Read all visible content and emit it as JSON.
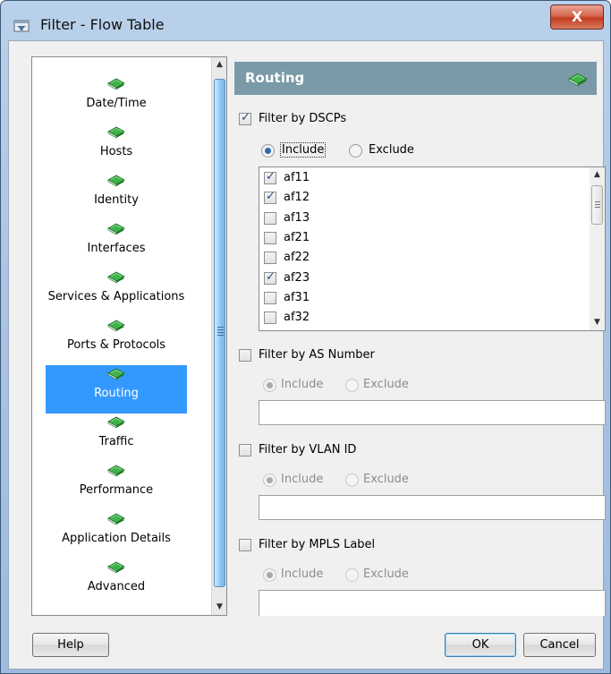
{
  "window": {
    "title": "Filter - Flow Table",
    "close_label": "X"
  },
  "nav": {
    "items": [
      {
        "label": "Date/Time"
      },
      {
        "label": "Hosts"
      },
      {
        "label": "Identity"
      },
      {
        "label": "Interfaces"
      },
      {
        "label": "Services & Applications"
      },
      {
        "label": "Ports & Protocols"
      },
      {
        "label": "Routing",
        "active": true
      },
      {
        "label": "Traffic"
      },
      {
        "label": "Performance"
      },
      {
        "label": "Application Details"
      },
      {
        "label": "Advanced"
      }
    ]
  },
  "panel": {
    "title": "Routing",
    "dscp": {
      "label": "Filter by DSCPs",
      "checked": true,
      "include_label": "Include",
      "exclude_label": "Exclude",
      "selected": "Include",
      "items": [
        {
          "label": "af11",
          "checked": true
        },
        {
          "label": "af12",
          "checked": true
        },
        {
          "label": "af13",
          "checked": false
        },
        {
          "label": "af21",
          "checked": false
        },
        {
          "label": "af22",
          "checked": false
        },
        {
          "label": "af23",
          "checked": true
        },
        {
          "label": "af31",
          "checked": false
        },
        {
          "label": "af32",
          "checked": false
        }
      ]
    },
    "as_number": {
      "label": "Filter by AS Number",
      "checked": false,
      "include_label": "Include",
      "exclude_label": "Exclude",
      "value": ""
    },
    "vlan": {
      "label": "Filter by VLAN ID",
      "checked": false,
      "include_label": "Include",
      "exclude_label": "Exclude",
      "value": ""
    },
    "mpls": {
      "label": "Filter by MPLS Label",
      "checked": false,
      "include_label": "Include",
      "exclude_label": "Exclude",
      "value": ""
    }
  },
  "footer": {
    "help_label": "Help",
    "ok_label": "OK",
    "cancel_label": "Cancel"
  },
  "colors": {
    "accent": "#3399ff",
    "header": "#7a9aa8",
    "book_green": "#2e9a3a"
  },
  "icons": {
    "title": "filter-window-icon",
    "nav": "green-book-icon",
    "header": "green-book-icon"
  }
}
